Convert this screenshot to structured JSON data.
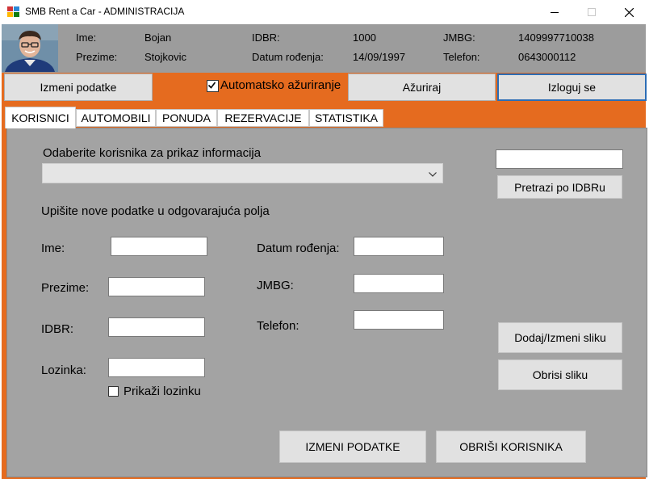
{
  "window": {
    "title": "SMB Rent a Car - ADMINISTRACIJA",
    "controls": [
      "minimize",
      "maximize",
      "close"
    ]
  },
  "header": {
    "ime_label": "Ime:",
    "ime_value": "Bojan",
    "prezime_label": "Prezime:",
    "prezime_value": "Stojkovic",
    "idbr_label": "IDBR:",
    "idbr_value": "1000",
    "datum_label": "Datum rođenja:",
    "datum_value": "14/09/1997",
    "jmbg_label": "JMBG:",
    "jmbg_value": "1409997710038",
    "telefon_label": "Telefon:",
    "telefon_value": "0643000112"
  },
  "toolbar": {
    "izmeni_podatke": "Izmeni podatke",
    "auto_update_label": "Automatsko ažuriranje",
    "auto_update_checked": true,
    "azuriraj": "Ažuriraj",
    "izloguj": "Izloguj se"
  },
  "tabs": [
    {
      "label": "KORISNICI",
      "active": true
    },
    {
      "label": "AUTOMOBILI",
      "active": false
    },
    {
      "label": "PONUDA",
      "active": false
    },
    {
      "label": "REZERVACIJE",
      "active": false
    },
    {
      "label": "STATISTIKA",
      "active": false
    }
  ],
  "korisnici": {
    "select_prompt": "Odaberite korisnika za prikaz informacija",
    "select_value": "",
    "search_value": "",
    "search_button": "Pretrazi po IDBRu",
    "new_data_prompt": "Upišite nove podatke u odgovarajuća polja",
    "fields": {
      "ime": "Ime:",
      "prezime": "Prezime:",
      "idbr": "IDBR:",
      "lozinka": "Lozinka:",
      "datum_rodjenja": "Datum rođenja:",
      "jmbg": "JMBG:",
      "telefon": "Telefon:"
    },
    "values": {
      "ime": "",
      "prezime": "",
      "idbr": "",
      "lozinka": "",
      "datum_rodjenja": "",
      "jmbg": "",
      "telefon": ""
    },
    "show_password_label": "Prikaži lozinku",
    "show_password_checked": false,
    "add_image_button": "Dodaj/Izmeni sliku",
    "delete_image_button": "Obrisi sliku",
    "update_button": "IZMENI PODATKE",
    "delete_user_button": "OBRIŠI KORISNIKA"
  },
  "colors": {
    "accent": "#e56b1f",
    "panel": "#a3a3a3",
    "header": "#9c9c9c",
    "button": "#e1e1e1",
    "focus_border": "#2c6db5"
  }
}
